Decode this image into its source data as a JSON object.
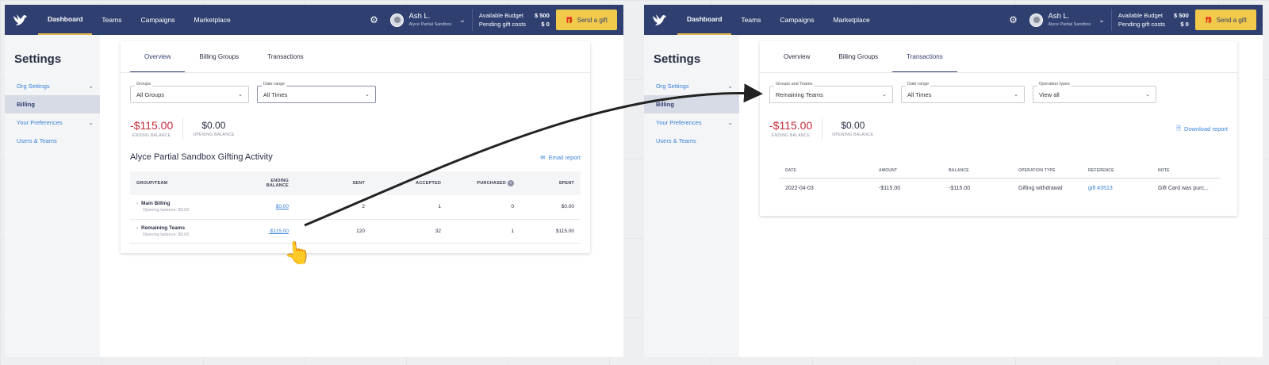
{
  "nav": {
    "items": [
      "Dashboard",
      "Teams",
      "Campaigns",
      "Marketplace"
    ],
    "user_name": "Ash L.",
    "user_org": "Alyce Partial Sandbox",
    "budget_label": "Available Budget",
    "budget_value": "$ 500",
    "pending_label": "Pending gift costs",
    "pending_value": "$ 0",
    "send_gift": "Send a gift"
  },
  "sidebar": {
    "title": "Settings",
    "items": [
      "Org Settings",
      "Billing",
      "Your Preferences",
      "Users & Teams"
    ]
  },
  "left": {
    "tabs": [
      "Overview",
      "Billing Groups",
      "Transactions"
    ],
    "filter1_label": "Groups",
    "filter1_value": "All Groups",
    "filter2_label": "Date range",
    "filter2_value": "All Times",
    "ending_balance": "-$115.00",
    "ending_label": "ENDING BALANCE",
    "opening_balance": "$0.00",
    "opening_label": "OPENING BALANCE",
    "activity_title": "Alyce Partial Sandbox Gifting Activity",
    "email_report": "Email report",
    "columns": [
      "GROUP/TEAM",
      "ENDING BALANCE",
      "SENT",
      "ACCEPTED",
      "PURCHASED",
      "SPENT"
    ],
    "rows": [
      {
        "name": "Main Billing",
        "sub": "Opening balance: $0.00",
        "ending": "$0.00",
        "sent": "2",
        "accepted": "1",
        "purchased": "0",
        "spent": "$0.00"
      },
      {
        "name": "Remaining Teams",
        "sub": "Opening balance: $0.00",
        "ending": "-$115.00",
        "sent": "120",
        "accepted": "32",
        "purchased": "1",
        "spent": "$115.00"
      }
    ]
  },
  "right": {
    "tabs": [
      "Overview",
      "Billing Groups",
      "Transactions"
    ],
    "filter1_label": "Groups and Teams",
    "filter1_value": "Remaining Teams",
    "filter2_label": "Date range",
    "filter2_value": "All Times",
    "filter3_label": "Operation types",
    "filter3_value": "View all",
    "ending_balance": "-$115.00",
    "ending_label": "ENDING BALANCE",
    "opening_balance": "$0.00",
    "opening_label": "OPENING BALANCE",
    "download_report": "Download report",
    "columns": [
      "DATE",
      "AMOUNT",
      "BALANCE",
      "OPERATION TYPE",
      "REFERENCE",
      "NOTE"
    ],
    "rows": [
      {
        "date": "2022-04-03",
        "amount": "-$115.00",
        "balance": "-$115.00",
        "type": "Gifting withdrawal",
        "reference": "gift #3513",
        "note": "Gift Card was purc..."
      }
    ]
  },
  "colors": {
    "nav_bg": "#2f3f70",
    "accent": "#f1c94b",
    "negative": "#c52a39",
    "link": "#3b82d8"
  }
}
